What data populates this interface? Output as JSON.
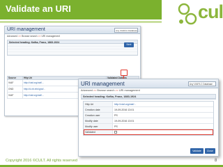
{
  "slide": {
    "title": "Validate an URI",
    "footer": "Copyright 2016 ©CULT. All rights reserved",
    "page_number": "8",
    "logo_text": "cult",
    "colors": {
      "accent": "#7bb12e",
      "highlight": "#e03a2f",
      "button": "#2f64a8"
    }
  },
  "back_screen": {
    "panel_title": "URI management",
    "select_value": "Any VIAF/LC Database",
    "breadcrumb": [
      "Advanced",
      "Browse search",
      "URI management"
    ],
    "selected_heading": "Selected heading: Kafka, Franz, 1883-1924",
    "next_label": "Next",
    "table": {
      "headers": [
        "Source",
        "Http Uri",
        "Validated Options"
      ],
      "rows": [
        {
          "source": "VIAF",
          "uri": "http://viaf.org/viaf/..."
        },
        {
          "source": "GND",
          "uri": "http://d-nb.info/gnd/..."
        },
        {
          "source": "VIAF",
          "uri": "http://viaf.org/viaf/..."
        }
      ]
    }
  },
  "front_screen": {
    "panel_title": "URI management",
    "select_value": "Any VIAF/LC Database",
    "breadcrumb": [
      "Advanced",
      "Browse search",
      "URI management"
    ],
    "selected_heading": "Selected heading: Kafka, Franz, 1883-1924",
    "form": {
      "http_uri_label": "Http Uri",
      "http_uri_value": "http://viaf.org/viaf/...",
      "creation_date_label": "Creation date",
      "creation_date_value": "19-09-2016 13:01",
      "creation_user_label": "Creation user",
      "creation_user_value": "PS",
      "modify_date_label": "Modify date",
      "modify_date_value": "19-09-2016 13:01",
      "modify_user_label": "Modify user",
      "modify_user_value": "PS",
      "validated_label": "Validated"
    },
    "buttons": {
      "validate": "Validate",
      "close": "Close"
    }
  }
}
